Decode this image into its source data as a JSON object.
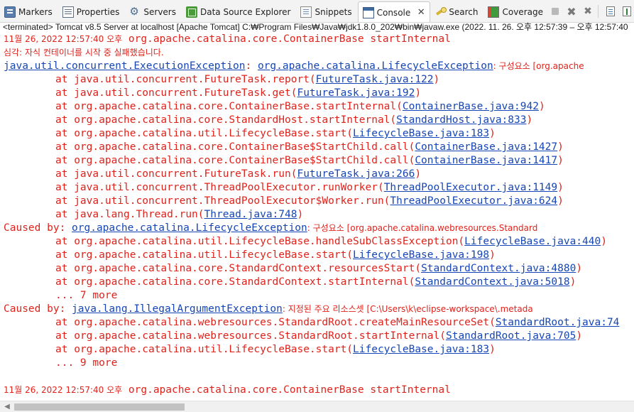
{
  "tabs": [
    {
      "label": "Markers",
      "icon": "markers-icon"
    },
    {
      "label": "Properties",
      "icon": "properties-icon"
    },
    {
      "label": "Servers",
      "icon": "servers-icon"
    },
    {
      "label": "Data Source Explorer",
      "icon": "data-source-explorer-icon"
    },
    {
      "label": "Snippets",
      "icon": "snippets-icon"
    },
    {
      "label": "Console",
      "icon": "console-icon",
      "active": true
    },
    {
      "label": "Search",
      "icon": "search-icon"
    },
    {
      "label": "Coverage",
      "icon": "coverage-icon"
    }
  ],
  "toolbar": {
    "buttons": [
      "terminate-icon",
      "remove-launch-icon",
      "remove-all-terminated-icon",
      "show-console-output-icon",
      "pin-console-icon"
    ],
    "tab_close": "✕"
  },
  "process_line": "<terminated> Tomcat v8.5 Server at localhost [Apache Tomcat] C:₩Program Files₩Java₩jdk1.8.0_202₩bin₩javaw.exe  (2022. 11. 26. 오후 12:57:39 – 오후 12:57:40",
  "console": {
    "header1": {
      "date": "11월 26, 2022 12:57:40 오후",
      "rest": " org.apache.catalina.core.ContainerBase startInternal"
    },
    "severe": "심각: 자식 컨테이너를 시작 중 실패했습니다.",
    "exception": {
      "link1": "java.util.concurrent.ExecutionException",
      "sep": ": ",
      "link2": "org.apache.catalina.LifecycleException",
      "tail": ": 구성요소 [org.apache"
    },
    "trace1": [
      {
        "text": "at java.util.concurrent.FutureTask.report(",
        "link": "FutureTask.java:122",
        "end": ")"
      },
      {
        "text": "at java.util.concurrent.FutureTask.get(",
        "link": "FutureTask.java:192",
        "end": ")"
      },
      {
        "text": "at org.apache.catalina.core.ContainerBase.startInternal(",
        "link": "ContainerBase.java:942",
        "end": ")"
      },
      {
        "text": "at org.apache.catalina.core.StandardHost.startInternal(",
        "link": "StandardHost.java:833",
        "end": ")"
      },
      {
        "text": "at org.apache.catalina.util.LifecycleBase.start(",
        "link": "LifecycleBase.java:183",
        "end": ")"
      },
      {
        "text": "at org.apache.catalina.core.ContainerBase$StartChild.call(",
        "link": "ContainerBase.java:1427",
        "end": ")"
      },
      {
        "text": "at org.apache.catalina.core.ContainerBase$StartChild.call(",
        "link": "ContainerBase.java:1417",
        "end": ")"
      },
      {
        "text": "at java.util.concurrent.FutureTask.run(",
        "link": "FutureTask.java:266",
        "end": ")"
      },
      {
        "text": "at java.util.concurrent.ThreadPoolExecutor.runWorker(",
        "link": "ThreadPoolExecutor.java:1149",
        "end": ")"
      },
      {
        "text": "at java.util.concurrent.ThreadPoolExecutor$Worker.run(",
        "link": "ThreadPoolExecutor.java:624",
        "end": ")"
      },
      {
        "text": "at java.lang.Thread.run(",
        "link": "Thread.java:748",
        "end": ")"
      }
    ],
    "caused1": {
      "prefix": "Caused by: ",
      "link": "org.apache.catalina.LifecycleException",
      "tail": ": 구성요소 [org.apache.catalina.webresources.Standard"
    },
    "trace2": [
      {
        "text": "at org.apache.catalina.util.LifecycleBase.handleSubClassException(",
        "link": "LifecycleBase.java:440",
        "end": ")"
      },
      {
        "text": "at org.apache.catalina.util.LifecycleBase.start(",
        "link": "LifecycleBase.java:198",
        "end": ")"
      },
      {
        "text": "at org.apache.catalina.core.StandardContext.resourcesStart(",
        "link": "StandardContext.java:4880",
        "end": ")"
      },
      {
        "text": "at org.apache.catalina.core.StandardContext.startInternal(",
        "link": "StandardContext.java:5018",
        "end": ")"
      }
    ],
    "more1": "... 7 more",
    "caused2": {
      "prefix": "Caused by: ",
      "link": "java.lang.IllegalArgumentException",
      "tail": ": 지정된 주요 리소스셋 [C:\\Users\\k\\eclipse-workspace\\.metada"
    },
    "trace3": [
      {
        "text": "at org.apache.catalina.webresources.StandardRoot.createMainResourceSet(",
        "link": "StandardRoot.java:74",
        "end": ""
      },
      {
        "text": "at org.apache.catalina.webresources.StandardRoot.startInternal(",
        "link": "StandardRoot.java:705",
        "end": ")"
      },
      {
        "text": "at org.apache.catalina.util.LifecycleBase.start(",
        "link": "LifecycleBase.java:183",
        "end": ")"
      }
    ],
    "more2": "... 9 more",
    "header2": {
      "date": "11월 26, 2022 12:57:40 오후",
      "rest": " org.apache.catalina.core.ContainerBase startInternal"
    }
  },
  "colors": {
    "error_text": "#e0221b",
    "link": "#1646b5"
  }
}
